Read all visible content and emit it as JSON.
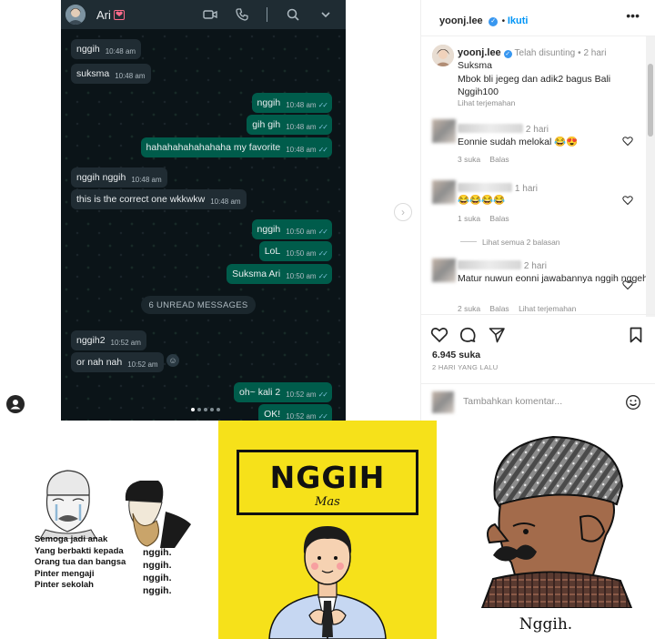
{
  "chat": {
    "contact_name": "Ari",
    "contact_emoji": "❤",
    "messages": [
      {
        "text": "nggih",
        "time": "10:48 am",
        "dir": "in"
      },
      {
        "text": "suksma",
        "time": "10:48 am",
        "dir": "in"
      },
      {
        "text": "nggih",
        "time": "10:48 am",
        "dir": "out"
      },
      {
        "text": "gih gih",
        "time": "10:48 am",
        "dir": "out"
      },
      {
        "text": "hahahahahahahaha my favorite",
        "time": "10:48 am",
        "dir": "out"
      },
      {
        "text": "nggih nggih",
        "time": "10:48 am",
        "dir": "in"
      },
      {
        "text": "this is the correct one wkkwkw",
        "time": "10:48 am",
        "dir": "in"
      },
      {
        "text": "nggih",
        "time": "10:50 am",
        "dir": "out"
      },
      {
        "text": "LoL",
        "time": "10:50 am",
        "dir": "out"
      },
      {
        "text": "Suksma Ari",
        "time": "10:50 am",
        "dir": "out"
      },
      {
        "text": "nggih2",
        "time": "10:52 am",
        "dir": "in"
      },
      {
        "text": "or nah nah",
        "time": "10:52 am",
        "dir": "in"
      },
      {
        "text": "oh~ kali 2",
        "time": "10:52 am",
        "dir": "out"
      },
      {
        "text": "OK!",
        "time": "10:52 am",
        "dir": "out"
      }
    ],
    "unread_label": "6 UNREAD MESSAGES",
    "ticks": "✓✓"
  },
  "instagram": {
    "username": "yoonj.lee",
    "follow_label": "Ikuti",
    "caption": {
      "username": "yoonj.lee",
      "edited": "Telah disunting",
      "age": "2 hari",
      "lines": [
        "Suksma",
        "Mbok bli jegeg dan adik2 bagus Bali",
        "Nggih100"
      ],
      "translate": "Lihat terjemahan"
    },
    "comments": [
      {
        "age": "2 hari",
        "text": "Eonnie sudah melokal 😂😍",
        "likes": "3 suka",
        "reply": "Balas"
      },
      {
        "age": "1 hari",
        "text": "😂😂😂😂",
        "likes": "1 suka",
        "reply": "Balas"
      },
      {
        "age": "2 hari",
        "text": "Matur nuwun eonni jawabannya nggih nggeh",
        "likes": "2 suka",
        "reply": "Balas",
        "translate": "Lihat terjemahan"
      }
    ],
    "view_replies": "Lihat semua 2 balasan",
    "likes": "6.945 suka",
    "date": "2 HARI YANG LALU",
    "comment_placeholder": "Tambahkan komentar..."
  },
  "memes": {
    "meme1_caption": [
      "Semoga jadi anak",
      "Yang berbakti kepada",
      "Orang tua dan bangsa",
      "Pinter mengaji",
      "Pinter sekolah"
    ],
    "meme1_reply": [
      "nggih.",
      "nggih.",
      "nggih.",
      "nggih."
    ],
    "meme2_title": "NGGIH",
    "meme2_subtitle": "Mas",
    "meme3_caption": "Nggih."
  }
}
